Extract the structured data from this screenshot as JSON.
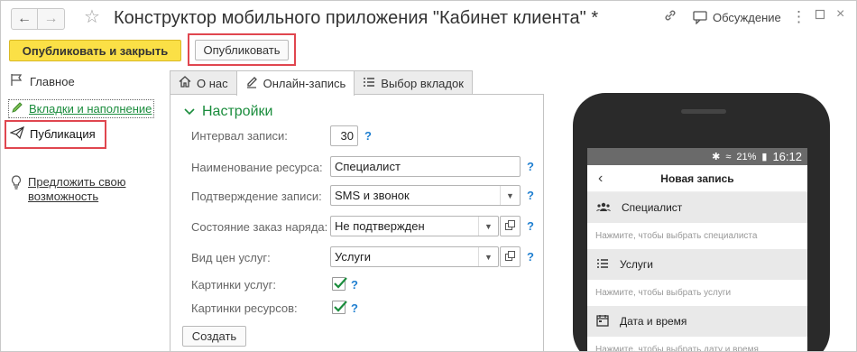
{
  "window": {
    "title": "Конструктор мобильного приложения \"Кабинет клиента\" *",
    "discuss_label": "Обсуждение"
  },
  "toolbar": {
    "publish_close_label": "Опубликовать и закрыть",
    "publish_label": "Опубликовать"
  },
  "sidebar": {
    "items": [
      {
        "label": "Главное"
      },
      {
        "label": "Вкладки и наполнение"
      },
      {
        "label": "Публикация"
      },
      {
        "label": "Предложить свою возможность"
      }
    ]
  },
  "tabs": [
    {
      "label": "О нас"
    },
    {
      "label": "Онлайн-запись"
    },
    {
      "label": "Выбор вкладок"
    }
  ],
  "form": {
    "section_title": "Настройки",
    "interval": {
      "label": "Интервал записи:",
      "value": "30"
    },
    "resource_name": {
      "label": "Наименование ресурса:",
      "value": "Специалист"
    },
    "confirmation": {
      "label": "Подтверждение записи:",
      "value": "SMS и звонок"
    },
    "order_state": {
      "label": "Состояние заказ наряда:",
      "value": "Не подтвержден"
    },
    "price_type": {
      "label": "Вид цен услуг:",
      "value": "Услуги"
    },
    "service_images": {
      "label": "Картинки услуг:",
      "checked": true
    },
    "resource_images": {
      "label": "Картинки ресурсов:",
      "checked": true
    },
    "help_glyph": "?",
    "create_label": "Создать"
  },
  "phone": {
    "status": {
      "battery": "21%",
      "time": "16:12"
    },
    "appbar_title": "Новая запись",
    "sections": [
      {
        "title": "Специалист",
        "hint": "Нажмите, чтобы выбрать специалиста"
      },
      {
        "title": "Услуги",
        "hint": "Нажмите, чтобы выбрать услуги"
      },
      {
        "title": "Дата и время",
        "hint": "Нажмите, чтобы выбрать дату и время"
      }
    ]
  },
  "colors": {
    "accent_yellow": "#fbe046",
    "highlight_red": "#e0464f",
    "green_link": "#1a8c3c",
    "help_blue": "#1f7fd0"
  },
  "icons": [
    "back-arrow-icon",
    "forward-arrow-icon",
    "star-icon",
    "link-icon",
    "discussion-icon",
    "more-icon",
    "flag-icon",
    "pencil-icon",
    "paper-plane-icon",
    "lightbulb-icon",
    "home-icon",
    "edit-icon",
    "list-icon",
    "chevron-down-icon",
    "open-form-icon",
    "help-icon",
    "checkbox-icon",
    "people-icon",
    "calendar-icon"
  ]
}
